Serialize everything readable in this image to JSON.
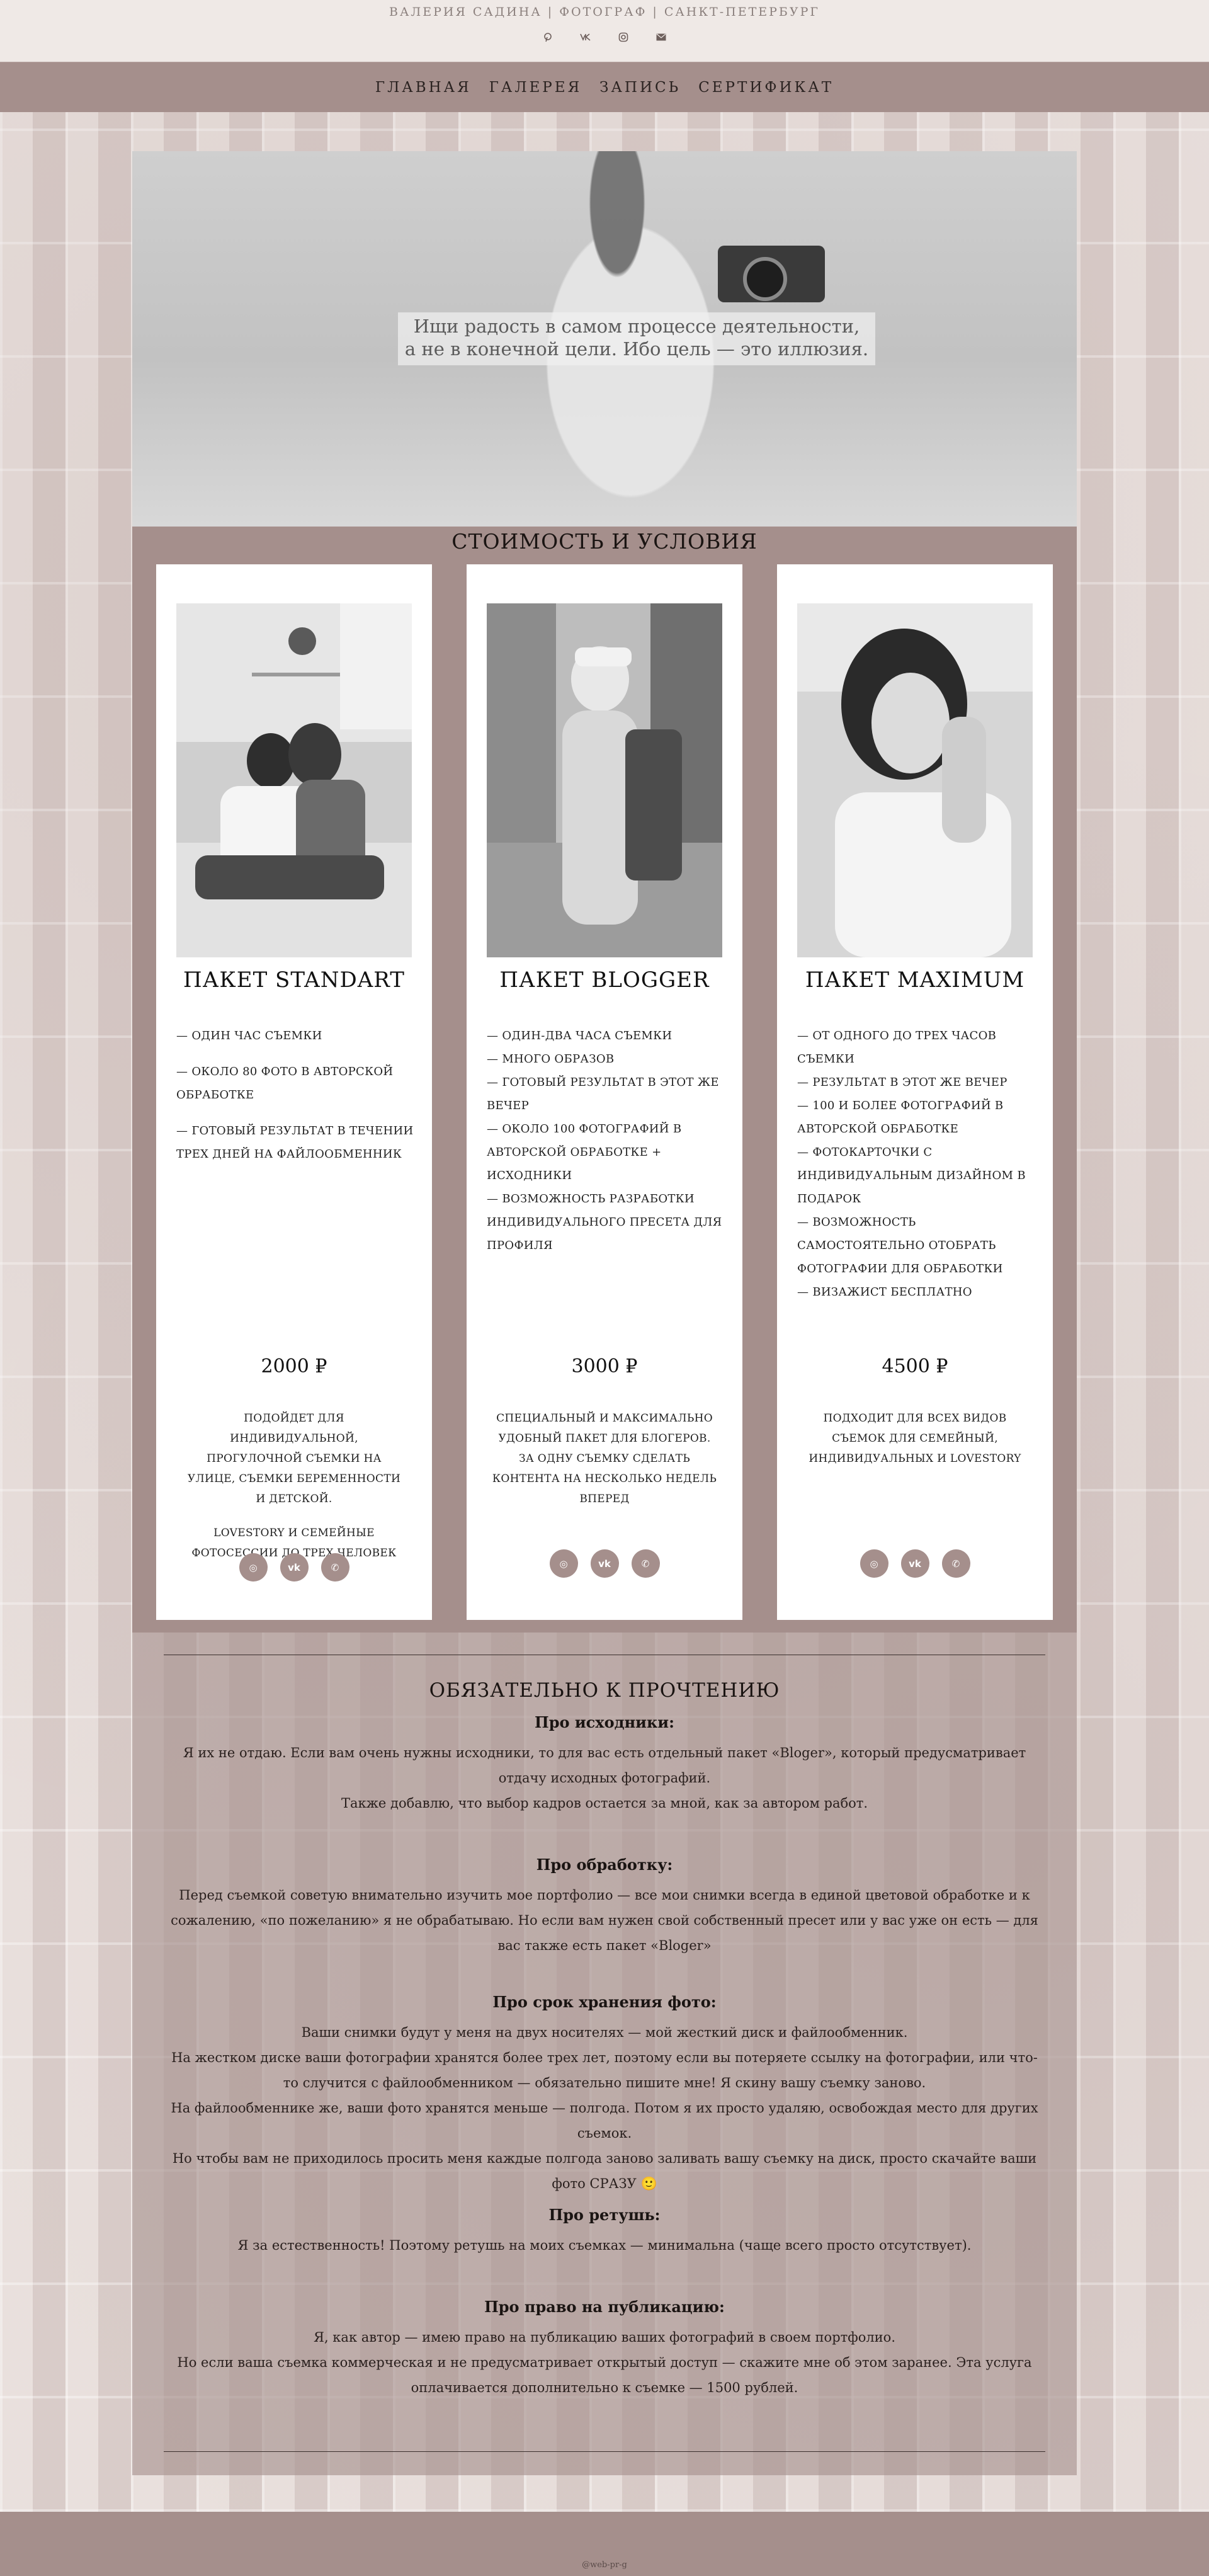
{
  "header": {
    "site_title": "ВАЛЕРИЯ САДИНА | ФОТОГРАФ | САНКТ-ПЕТЕРБУРГ",
    "social_icons": [
      "pinterest-icon",
      "vk-icon",
      "instagram-icon",
      "mail-icon"
    ]
  },
  "nav": {
    "items": [
      "ГЛАВНАЯ",
      "ГАЛЕРЕЯ",
      "ЗАПИСЬ",
      "СЕРТИФИКАТ"
    ]
  },
  "hero": {
    "quote_line1": "Ищи радость в самом процессе деятельности,",
    "quote_line2": "а не в конечной цели. Ибо цель — это иллюзия."
  },
  "pricing": {
    "title": "СТОИМОСТЬ И УСЛОВИЯ",
    "cards": [
      {
        "title": "ПАКЕТ STANDART",
        "features": [
          "— ОДИН ЧАС СЪЕМКИ",
          "— ОКОЛО 80 ФОТО В АВТОРСКОЙ ОБРАБОТКЕ",
          "— ГОТОВЫЙ РЕЗУЛЬТАТ В ТЕЧЕНИИ ТРЕХ ДНЕЙ НА ФАЙЛООБМЕННИК"
        ],
        "price": "2000 ₽",
        "desc1": "ПОДОЙДЕТ ДЛЯ ИНДИВИДУАЛЬНОЙ, ПРОГУЛОЧНОЙ СЪЕМКИ НА УЛИЦЕ, СЪЕМКИ БЕРЕМЕННОСТИ И ДЕТСКОЙ.",
        "desc2": "LOVESTORY И СЕМЕЙНЫЕ ФОТОСЕССИИ ДО ТРЕХ ЧЕЛОВЕК"
      },
      {
        "title": "ПАКЕТ BLOGGER",
        "features": [
          "— ОДИН-ДВА ЧАСА СЪЕМКИ",
          "— МНОГО ОБРАЗОВ",
          "— ГОТОВЫЙ РЕЗУЛЬТАТ В ЭТОТ ЖЕ ВЕЧЕР",
          "— ОКОЛО 100 ФОТОГРАФИЙ В АВТОРСКОЙ ОБРАБОТКЕ + ИСХОДНИКИ",
          "— ВОЗМОЖНОСТЬ РАЗРАБОТКИ ИНДИВИДУАЛЬНОГО ПРЕСЕТА ДЛЯ ПРОФИЛЯ"
        ],
        "price": "3000 ₽",
        "desc1": "СПЕЦИАЛЬНЫЙ И МАКСИМАЛЬНО УДОБНЫЙ ПАКЕТ ДЛЯ БЛОГЕРОВ. ЗА ОДНУ СЪЕМКУ СДЕЛАТЬ КОНТЕНТА НА НЕСКОЛЬКО НЕДЕЛЬ ВПЕРЕД",
        "desc2": ""
      },
      {
        "title": "ПАКЕТ MAXIMUM",
        "features": [
          "— ОТ ОДНОГО ДО ТРЕХ ЧАСОВ СЪЕМКИ",
          "— РЕЗУЛЬТАТ В ЭТОТ ЖЕ ВЕЧЕР",
          "— 100 И БОЛЕЕ ФОТОГРАФИЙ В АВТОРСКОЙ ОБРАБОТКЕ",
          "— ФОТОКАРТОЧКИ С ИНДИВИДУАЛЬНЫМ ДИЗАЙНОМ В ПОДАРОК",
          "— ВОЗМОЖНОСТЬ САМОСТОЯТЕЛЬНО ОТОБРАТЬ ФОТОГРАФИИ ДЛЯ ОБРАБОТКИ",
          "— ВИЗАЖИСТ БЕСПЛАТНО"
        ],
        "price": "4500 ₽",
        "desc1": "ПОДХОДИТ ДЛЯ ВСЕХ ВИДОВ СЪЕМОК ДЛЯ СЕМЕЙНЫЙ, ИНДИВИДУАЛЬНЫХ И LOVESTORY",
        "desc2": ""
      }
    ],
    "card_social_icons": [
      "instagram-icon",
      "vk-icon",
      "whatsapp-icon"
    ]
  },
  "info": {
    "title": "ОБЯЗАТЕЛЬНО К ПРОЧТЕНИЮ",
    "sections": [
      {
        "heading": "Про исходники:",
        "lines": [
          "Я их не отдаю. Если вам очень нужны исходники, то для вас есть отдельный пакет «Bloger», который предусматривает отдачу исходных фотографий.",
          "Также добавлю, что выбор кадров остается за мной, как за автором работ."
        ]
      },
      {
        "heading": "Про обработку:",
        "lines": [
          "Перед съемкой советую внимательно изучить мое портфолио — все мои снимки всегда в единой цветовой обработке и к сожалению, «по пожеланию» я не обрабатываю. Но если вам нужен свой собственный пресет или у вас уже он есть — для вас также есть пакет «Bloger»"
        ]
      },
      {
        "heading": "Про срок хранения фото:",
        "lines": [
          "Ваши снимки будут у меня на двух носителях — мой жесткий диск и файлообменник.",
          "На жестком диске ваши фотографии хранятся более трех лет, поэтому если вы потеряете ссылку на фотографии, или что-то случится с файлообменником — обязательно пишите мне! Я скину вашу съемку заново.",
          "На файлообменнике же, ваши фото хранятся меньше — полгода. Потом я их просто удаляю, освобождая место для других съемок.",
          "Но чтобы вам не приходилось просить меня каждые полгода заново заливать вашу съемку на диск, просто скачайте ваши фото СРАЗУ 🙂"
        ]
      },
      {
        "heading": "Про ретушь:",
        "lines": [
          "Я за естественность! Поэтому ретушь на моих съемках — минимальна (чаще всего просто отсутствует)."
        ]
      },
      {
        "heading": "Про право на публикацию:",
        "lines": [
          "Я, как автор — имею право на публикацию ваших фотографий в своем портфолио.",
          "Но если ваша съемка коммерческая и не предусматривает открытый доступ — скажите мне об этом заранее. Эта услуга оплачивается дополнительно к съемке — 1500 рублей."
        ]
      }
    ]
  },
  "footer": {
    "credit": "@web-pr-g"
  },
  "colors": {
    "accent": "#a58f8c",
    "page_bg": "#efe9e6",
    "card_bg": "#ffffff"
  }
}
